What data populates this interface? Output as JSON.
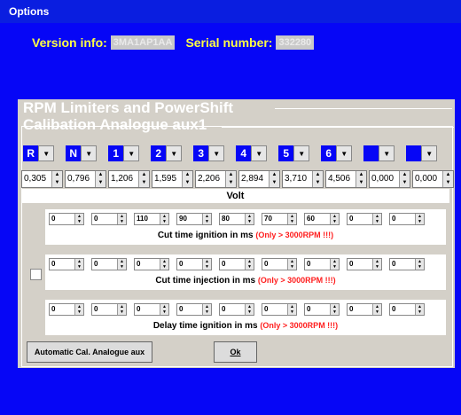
{
  "window": {
    "title": "Options"
  },
  "info": {
    "version_label": "Version info:",
    "version_value": "3MA1AP1AA",
    "serial_label": "Serial number:",
    "serial_value": "332280"
  },
  "section": {
    "title": "RPM Limiters and PowerShift",
    "subtitle": "Calibation Analogue aux1"
  },
  "gears": [
    "R",
    "N",
    "1",
    "2",
    "3",
    "4",
    "5",
    "6",
    "",
    ""
  ],
  "values": [
    "0,305",
    "0,796",
    "1,206",
    "1,595",
    "2,206",
    "2,894",
    "3,710",
    "4,506",
    "0,000",
    "0,000"
  ],
  "unit_label": "Volt",
  "groups": [
    {
      "values": [
        "0",
        "0",
        "110",
        "90",
        "80",
        "70",
        "60",
        "0",
        "0"
      ],
      "label": "Cut time ignition in ms",
      "note": "(Only > 3000RPM !!!)"
    },
    {
      "values": [
        "0",
        "0",
        "0",
        "0",
        "0",
        "0",
        "0",
        "0",
        "0"
      ],
      "label": "Cut time injection in ms",
      "note": "(Only > 3000RPM !!!)"
    },
    {
      "values": [
        "0",
        "0",
        "0",
        "0",
        "0",
        "0",
        "0",
        "0",
        "0"
      ],
      "label": "Delay time ignition in ms",
      "note": "(Only > 3000RPM !!!)"
    }
  ],
  "buttons": {
    "auto_cal": "Automatic Cal. Analogue aux",
    "ok": "Ok"
  },
  "colors": {
    "background": "#0606f6",
    "title_text": "#ffff44",
    "warning": "#ff1e1e"
  }
}
